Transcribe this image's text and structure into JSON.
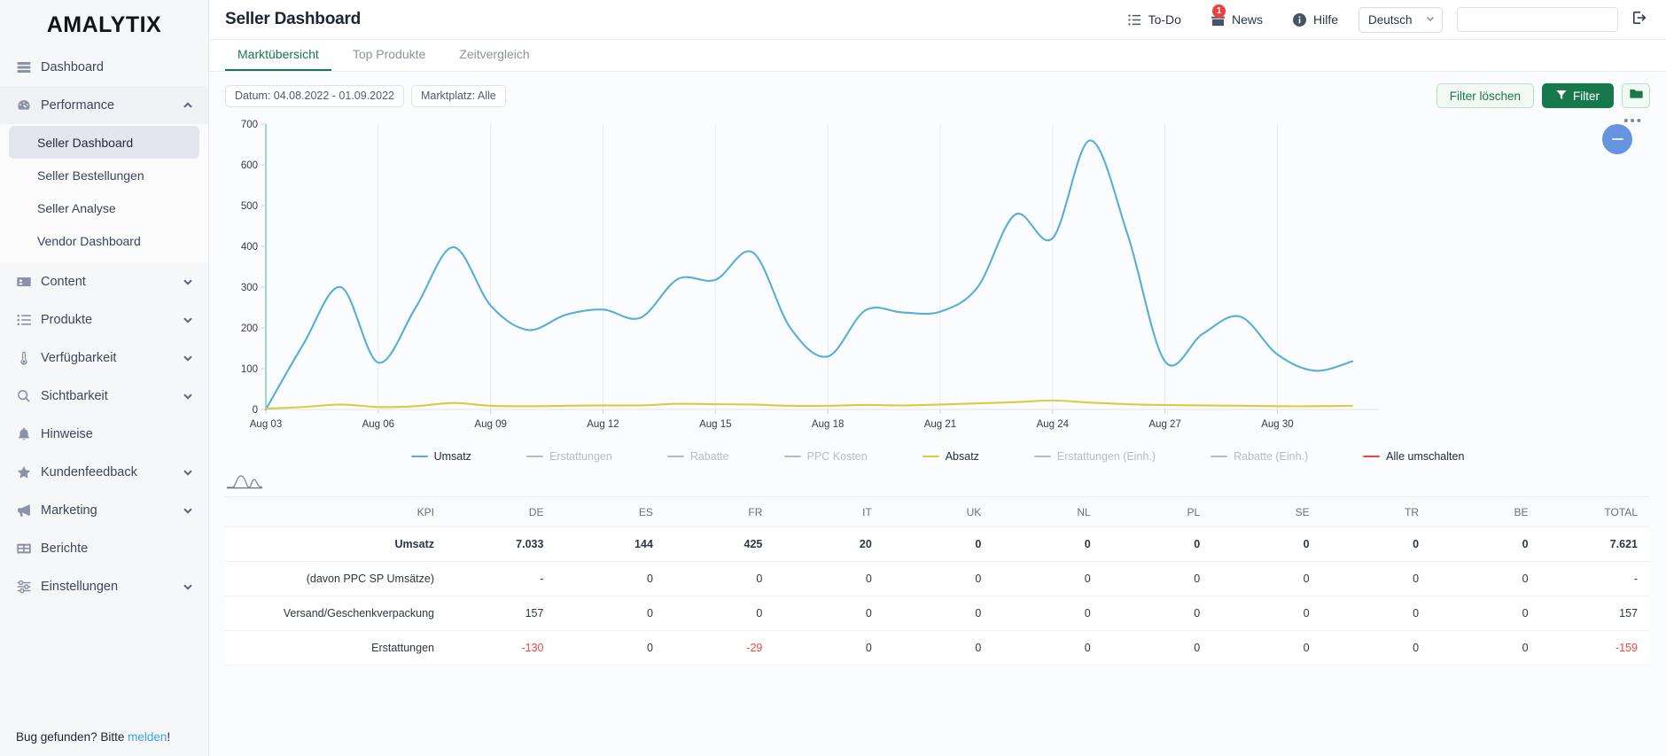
{
  "brand": {
    "name": "AMALYTIX"
  },
  "sidebar": {
    "items": [
      {
        "label": "Dashboard",
        "icon": "dashboard-icon",
        "expandable": false
      },
      {
        "label": "Performance",
        "icon": "gauge-icon",
        "expandable": true
      },
      {
        "label": "Content",
        "icon": "content-card-icon",
        "expandable": true
      },
      {
        "label": "Produkte",
        "icon": "list-icon",
        "expandable": true
      },
      {
        "label": "Verfügbarkeit",
        "icon": "thermometer-icon",
        "expandable": true
      },
      {
        "label": "Sichtbarkeit",
        "icon": "search-icon",
        "expandable": true
      },
      {
        "label": "Hinweise",
        "icon": "bell-icon",
        "expandable": false
      },
      {
        "label": "Kundenfeedback",
        "icon": "star-icon",
        "expandable": true
      },
      {
        "label": "Marketing",
        "icon": "megaphone-icon",
        "expandable": true
      },
      {
        "label": "Berichte",
        "icon": "table-icon",
        "expandable": false
      },
      {
        "label": "Einstellungen",
        "icon": "sliders-icon",
        "expandable": true
      }
    ],
    "performance_children": [
      {
        "label": "Seller Dashboard",
        "selected": true
      },
      {
        "label": "Seller Bestellungen",
        "selected": false
      },
      {
        "label": "Seller Analyse",
        "selected": false
      },
      {
        "label": "Vendor Dashboard",
        "selected": false
      }
    ],
    "footer": {
      "text_before": "Bug gefunden? Bitte ",
      "link": "melden",
      "text_after": "!"
    }
  },
  "header": {
    "title": "Seller Dashboard",
    "todo_label": "To-Do",
    "news_label": "News",
    "news_badge": "1",
    "help_label": "Hilfe",
    "language_value": "Deutsch",
    "search_value": "",
    "search_placeholder": ""
  },
  "tabs": [
    {
      "label": "Marktübersicht",
      "active": true
    },
    {
      "label": "Top Produkte",
      "active": false
    },
    {
      "label": "Zeitvergleich",
      "active": false
    }
  ],
  "filters": {
    "date_chip": "Datum: 04.08.2022 - 01.09.2022",
    "marketplace_chip": "Marktplatz: Alle",
    "clear_label": "Filter löschen",
    "filter_label": "Filter",
    "folder_icon": "folder-icon",
    "kebab_icon": "more-options-icon"
  },
  "colors": {
    "accent_green": "#17794b",
    "umsatz_blue": "#57aedb",
    "absatz_yellow": "#d9cb46",
    "toggle_red": "#f4453f",
    "negative_red": "#f4453f",
    "zoom_blue": "#6694e0"
  },
  "chart_data": {
    "type": "line",
    "title": "",
    "xlabel": "",
    "ylabel": "",
    "ylim": [
      0,
      700
    ],
    "yticks": [
      0,
      100,
      200,
      300,
      400,
      500,
      600,
      700
    ],
    "xticks": [
      "Aug 03",
      "Aug 06",
      "Aug 09",
      "Aug 12",
      "Aug 15",
      "Aug 18",
      "Aug 21",
      "Aug 24",
      "Aug 27",
      "Aug 30"
    ],
    "grid": "vertical",
    "legend_position": "bottom",
    "x": [
      "Aug 03",
      "Aug 04",
      "Aug 05",
      "Aug 06",
      "Aug 07",
      "Aug 08",
      "Aug 09",
      "Aug 10",
      "Aug 11",
      "Aug 12",
      "Aug 13",
      "Aug 14",
      "Aug 15",
      "Aug 16",
      "Aug 17",
      "Aug 18",
      "Aug 19",
      "Aug 20",
      "Aug 21",
      "Aug 22",
      "Aug 23",
      "Aug 24",
      "Aug 25",
      "Aug 26",
      "Aug 27",
      "Aug 28",
      "Aug 29",
      "Aug 30",
      "Aug 31",
      "Sep 01"
    ],
    "series": [
      {
        "name": "Umsatz",
        "color": "#57aedb",
        "visible": true,
        "values": [
          0,
          160,
          300,
          115,
          250,
          398,
          255,
          195,
          232,
          245,
          225,
          320,
          318,
          385,
          200,
          130,
          243,
          238,
          240,
          300,
          478,
          420,
          660,
          430,
          118,
          185,
          228,
          135,
          95,
          118
        ]
      },
      {
        "name": "Absatz",
        "color": "#d9cb46",
        "visible": true,
        "values": [
          2,
          6,
          12,
          6,
          8,
          16,
          9,
          8,
          9,
          10,
          10,
          14,
          13,
          12,
          9,
          9,
          11,
          10,
          12,
          15,
          18,
          22,
          17,
          13,
          11,
          10,
          9,
          8,
          8,
          9
        ]
      },
      {
        "name": "Erstattungen",
        "color": "#aab1bd",
        "visible": false,
        "values": []
      },
      {
        "name": "Rabatte",
        "color": "#aab1bd",
        "visible": false,
        "values": []
      },
      {
        "name": "PPC Kosten",
        "color": "#aab1bd",
        "visible": false,
        "values": []
      },
      {
        "name": "Erstattungen (Einh.)",
        "color": "#aab1bd",
        "visible": false,
        "values": []
      },
      {
        "name": "Rabatte (Einh.)",
        "color": "#aab1bd",
        "visible": false,
        "values": []
      }
    ],
    "legend": [
      {
        "label": "Umsatz",
        "color": "#57aedb",
        "active": true
      },
      {
        "label": "Erstattungen",
        "color": "#b6bcc7",
        "active": false
      },
      {
        "label": "Rabatte",
        "color": "#b6bcc7",
        "active": false
      },
      {
        "label": "PPC Kosten",
        "color": "#b6bcc7",
        "active": false
      },
      {
        "label": "Absatz",
        "color": "#d9cb46",
        "active": true
      },
      {
        "label": "Erstattungen (Einh.)",
        "color": "#b6bcc7",
        "active": false
      },
      {
        "label": "Rabatte (Einh.)",
        "color": "#b6bcc7",
        "active": false
      },
      {
        "label": "Alle umschalten",
        "color": "#f4453f",
        "active": true
      }
    ]
  },
  "table": {
    "columns": [
      "KPI",
      "DE",
      "ES",
      "FR",
      "IT",
      "UK",
      "NL",
      "PL",
      "SE",
      "TR",
      "BE",
      "TOTAL"
    ],
    "rows": [
      {
        "kpi": "Umsatz",
        "bold": true,
        "cells": [
          "7.033",
          "144",
          "425",
          "20",
          "0",
          "0",
          "0",
          "0",
          "0",
          "0",
          "7.621"
        ],
        "neg": [
          false,
          false,
          false,
          false,
          false,
          false,
          false,
          false,
          false,
          false,
          false
        ]
      },
      {
        "kpi": "(davon PPC SP Umsätze)",
        "bold": false,
        "cells": [
          "-",
          "0",
          "0",
          "0",
          "0",
          "0",
          "0",
          "0",
          "0",
          "0",
          "-"
        ],
        "neg": [
          false,
          false,
          false,
          false,
          false,
          false,
          false,
          false,
          false,
          false,
          false
        ]
      },
      {
        "kpi": "Versand/Geschenkverpackung",
        "bold": false,
        "cells": [
          "157",
          "0",
          "0",
          "0",
          "0",
          "0",
          "0",
          "0",
          "0",
          "0",
          "157"
        ],
        "neg": [
          false,
          false,
          false,
          false,
          false,
          false,
          false,
          false,
          false,
          false,
          false
        ]
      },
      {
        "kpi": "Erstattungen",
        "bold": false,
        "cells": [
          "-130",
          "0",
          "-29",
          "0",
          "0",
          "0",
          "0",
          "0",
          "0",
          "0",
          "-159"
        ],
        "neg": [
          true,
          false,
          true,
          false,
          false,
          false,
          false,
          false,
          false,
          false,
          true
        ]
      }
    ]
  }
}
